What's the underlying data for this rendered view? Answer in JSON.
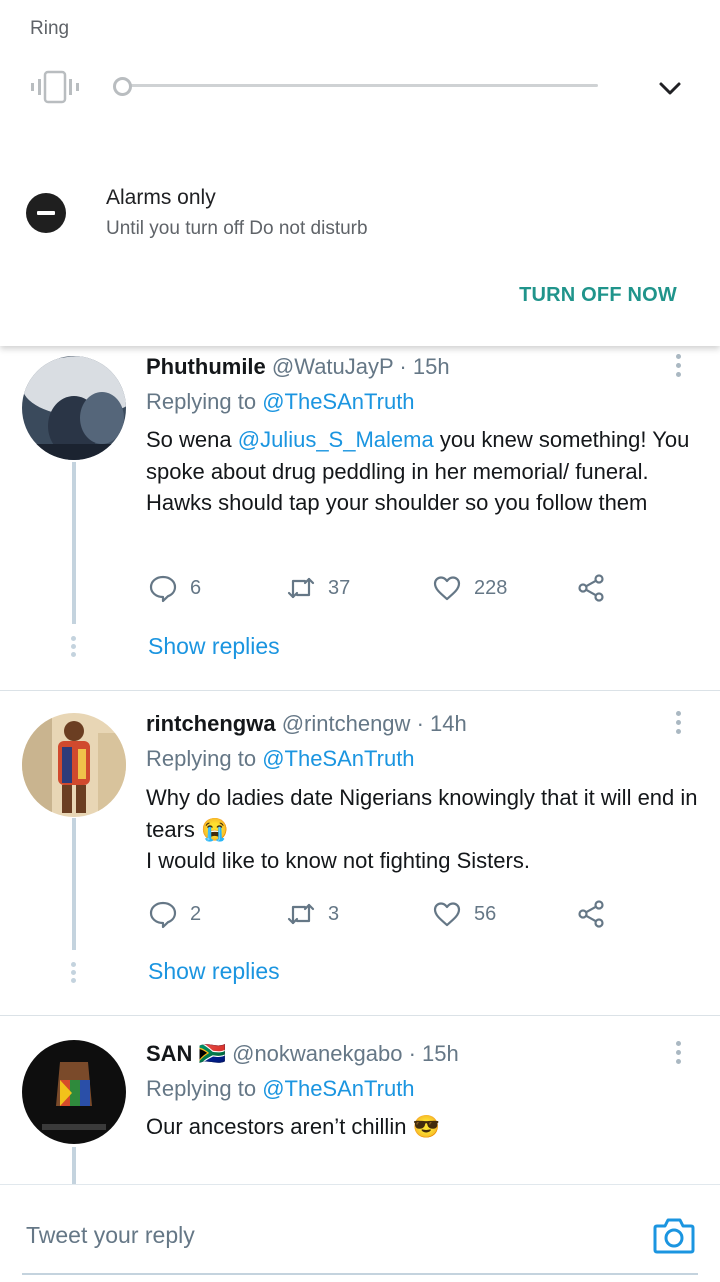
{
  "volume_panel": {
    "ring_label": "Ring",
    "vibrate_icon": "vibrate-icon",
    "expand_icon": "chevron-down-icon",
    "volume_level": 0.0
  },
  "dnd": {
    "icon": "do-not-disturb-icon",
    "title": "Alarms only",
    "subtitle": "Until you turn off Do not disturb",
    "turn_off_label": "TURN OFF NOW",
    "accent_color": "#20948b"
  },
  "tweets": [
    {
      "name": "Phuthumile",
      "handle": "@WatuJayP",
      "time": "· 15h",
      "replying_prefix": "Replying to ",
      "replying_to": "@TheSAnTruth",
      "text_prefix": "So wena ",
      "mention": "@Julius_S_Malema",
      "text_rest": " you knew something! You spoke about drug peddling in her memorial/ funeral. Hawks should tap your shoulder so you follow them",
      "replies": "6",
      "retweets": "37",
      "likes": "228",
      "show_replies": "Show replies"
    },
    {
      "name": "rintchengwa",
      "handle": "@rintchengw",
      "time": "· 14h",
      "replying_prefix": "Replying to ",
      "replying_to": "@TheSAnTruth",
      "text_line1": "Why do ladies date Nigerians  knowingly that it will end in tears",
      "emoji1": "😭",
      "text_line2": "I would like to know not fighting Sisters.",
      "replies": "2",
      "retweets": "3",
      "likes": "56",
      "show_replies": "Show replies"
    },
    {
      "name": "SAN",
      "flag_emoji": "🇿🇦",
      "handle": "@nokwanekgabo",
      "time": "· 15h",
      "replying_prefix": "Replying to ",
      "replying_to": "@TheSAnTruth",
      "text": "Our ancestors aren’t chillin",
      "emoji": "😎",
      "avatar_caption": "WE ARE SOUTH AFRICA"
    }
  ],
  "reply_bar": {
    "placeholder": "Tweet your reply",
    "camera_icon": "camera-icon"
  },
  "colors": {
    "link": "#1b95e0",
    "muted": "#657786",
    "thread": "#c4d3de"
  }
}
